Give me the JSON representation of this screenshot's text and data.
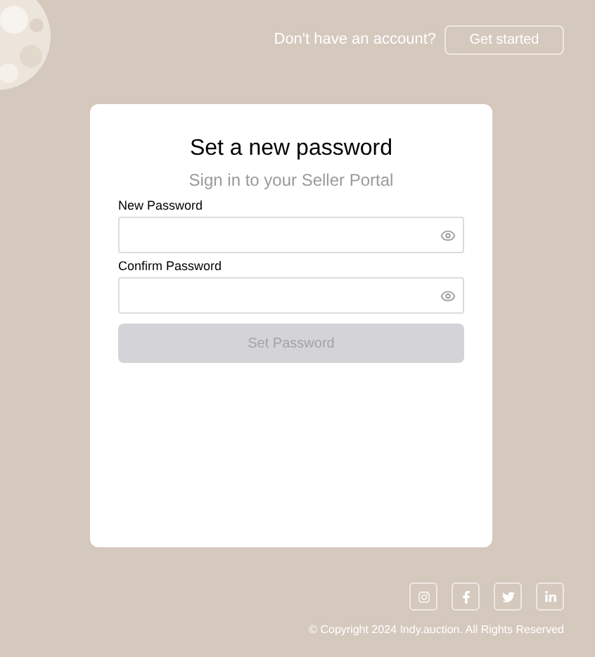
{
  "header": {
    "prompt": "Don't have an account?",
    "button": "Get started"
  },
  "card": {
    "title": "Set a new password",
    "subtitle": "Sign in to your Seller Portal",
    "fields": [
      {
        "label": "New Password",
        "masked": true
      },
      {
        "label": "Confirm Password",
        "masked": true
      }
    ],
    "submit": {
      "label": "Set Password",
      "disabled": true
    }
  },
  "footer": {
    "social": [
      {
        "kind": "instagram"
      },
      {
        "kind": "facebook"
      },
      {
        "kind": "twitter"
      },
      {
        "kind": "linkedin"
      }
    ],
    "copyright": "© Copyright 2024 Indy.auction. All Rights Reserved"
  }
}
